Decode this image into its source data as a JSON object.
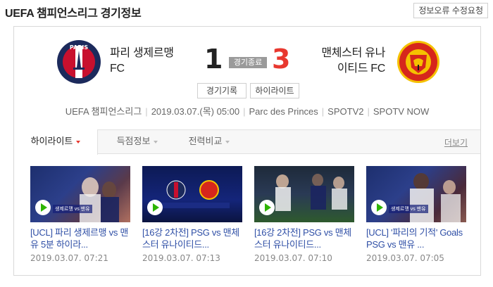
{
  "page": {
    "title": "UEFA 챔피언스리그 경기정보",
    "report_button": "정보오류 수정요청"
  },
  "match": {
    "home": {
      "name_line1": "파리 생제르맹",
      "name_line2": "FC",
      "score": "1"
    },
    "away": {
      "name_line1": "맨체스터 유나",
      "name_line2": "이티드 FC",
      "score": "3"
    },
    "status": "경기종료",
    "buttons": {
      "record": "경기기록",
      "highlight": "하이라이트"
    },
    "info": {
      "league": "UEFA 챔피언스리그",
      "datetime": "2019.03.07.(목) 05:00",
      "venue": "Parc des Princes",
      "broadcaster1": "SPOTV2",
      "broadcaster2": "SPOTV NOW"
    }
  },
  "tabs": [
    {
      "label": "하이라이트",
      "active": true
    },
    {
      "label": "득점정보",
      "active": false
    },
    {
      "label": "전력비교",
      "active": false
    }
  ],
  "more_link": "더보기",
  "videos": [
    {
      "title": "[UCL] 파리 생제르맹 vs 맨유 5분 하이라...",
      "date": "2019.03.07. 07:21",
      "caption": "생제르맹 vs 맨유"
    },
    {
      "title": "[16강 2차전] PSG vs 맨체스터 유나이티드...",
      "date": "2019.03.07. 07:13",
      "caption": ""
    },
    {
      "title": "[16강 2차전] PSG vs 맨체스터 유나이티드...",
      "date": "2019.03.07. 07:10",
      "caption": ""
    },
    {
      "title": "[UCL] '파리의 기적' Goals PSG vs 맨유 ...",
      "date": "2019.03.07. 07:05",
      "caption": "생제르맹 vs 맨유"
    }
  ],
  "footnote": "",
  "colors": {
    "accent_red": "#e8382f",
    "link_blue": "#2f4fa6",
    "psg_navy": "#1c2a5c",
    "manu_red": "#d6261c",
    "manu_gold": "#f5c100"
  }
}
